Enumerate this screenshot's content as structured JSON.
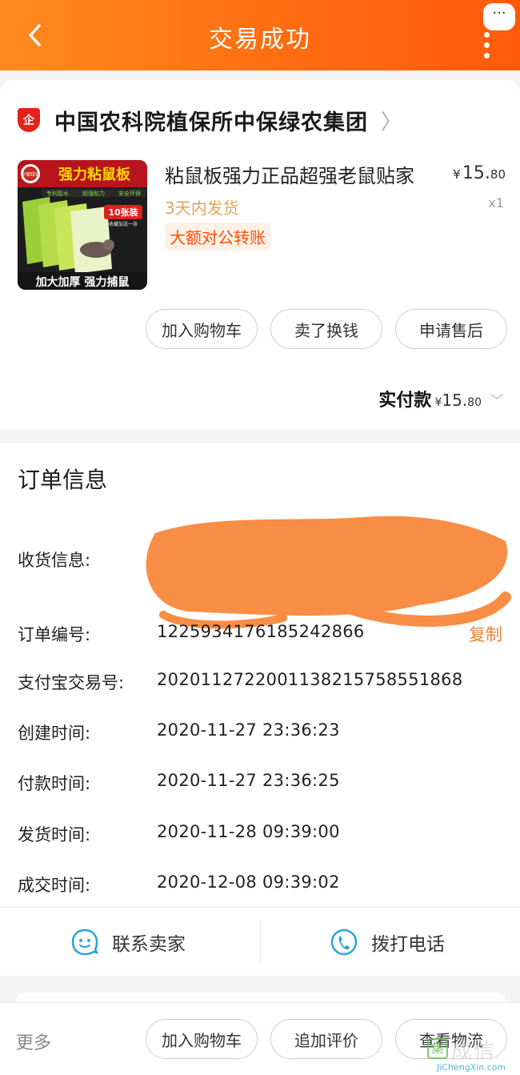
{
  "header": {
    "title": "交易成功",
    "more_bubble": "···"
  },
  "shop": {
    "badge": "企",
    "name": "中国农科院植保所中保绿农集团",
    "chevron": "〉"
  },
  "product": {
    "title": "粘鼠板强力正品超强老鼠贴家",
    "price_currency": "¥",
    "price_int": "15.",
    "price_dec": "80",
    "qty": "x1",
    "shipping": "3天内发货",
    "tag": "大额对公转账",
    "image_text": {
      "brand": "中保绿农",
      "headline": "强力粘鼠板",
      "sub_left": "专利胶水",
      "sub_mid": "超强粘力",
      "sub_right": "安全环保",
      "count": "10张装",
      "gift": "收藏加送一张",
      "bottom": "加大加厚 强力捕鼠"
    }
  },
  "actions": {
    "add_cart": "加入购物车",
    "sell": "卖了换钱",
    "after_sale": "申请售后"
  },
  "paid": {
    "label": "实付款",
    "currency": "¥",
    "int": "15.",
    "dec": "80"
  },
  "order": {
    "title": "订单信息",
    "rows": [
      {
        "label": "收货信息:",
        "value": ""
      },
      {
        "label": "订单编号:",
        "value": "1225934176185242866"
      },
      {
        "label": "支付宝交易号:",
        "value": "2020112722001138215758551868"
      },
      {
        "label": "创建时间:",
        "value": "2020-11-27 23:36:23"
      },
      {
        "label": "付款时间:",
        "value": "2020-11-27 23:36:25"
      },
      {
        "label": "发货时间:",
        "value": "2020-11-28 09:39:00"
      },
      {
        "label": "成交时间:",
        "value": "2020-12-08 09:39:02"
      }
    ],
    "copy": "复制"
  },
  "contact": {
    "seller": "联系卖家",
    "call": "拨打电话"
  },
  "bottom": {
    "more": "更多",
    "add_cart": "加入购物车",
    "review": "追加评价",
    "logistics": "查看物流"
  },
  "watermark": {
    "box": "集",
    "text": "成信",
    "url": "JiChengXin.com"
  },
  "colors": {
    "accent": "#ff6a10",
    "price_tag": "#ff5000",
    "copy": "#e8823a",
    "icon": "#2aa3d8"
  }
}
